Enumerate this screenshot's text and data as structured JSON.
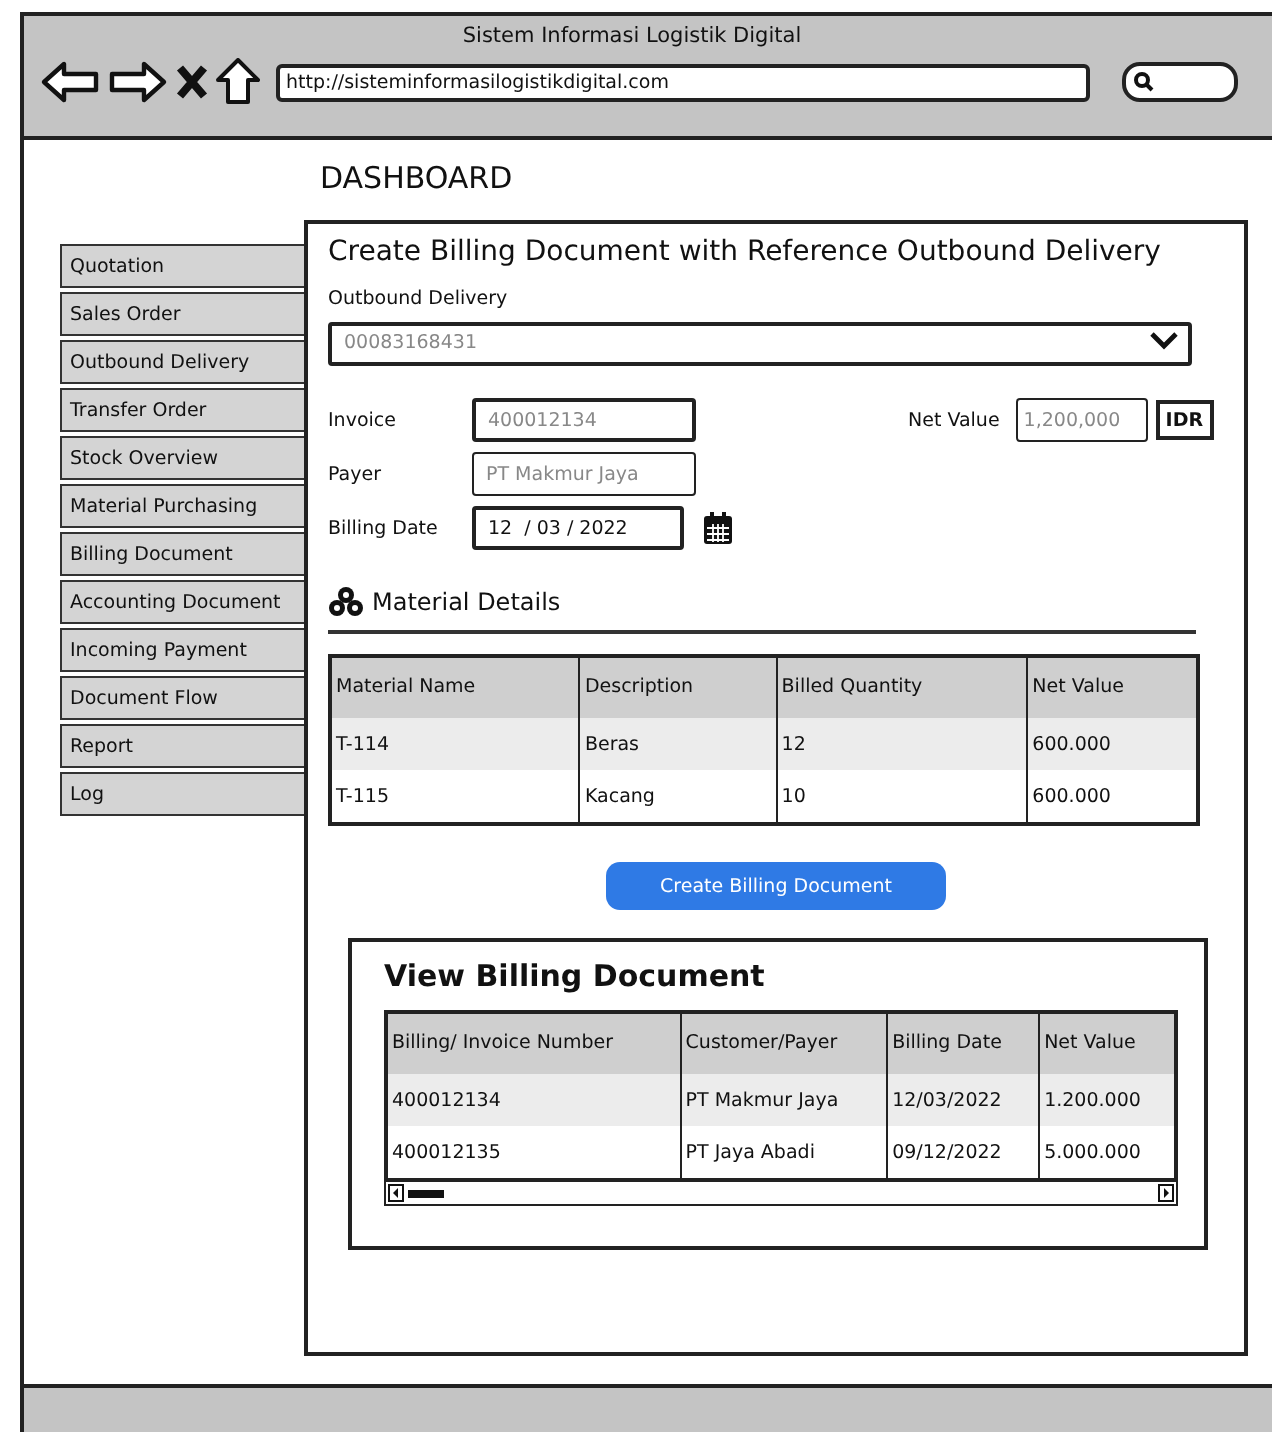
{
  "window": {
    "title": "Sistem Informasi Logistik Digital",
    "url": "http://sisteminformasilogistikdigital.com"
  },
  "page_title": "DASHBOARD",
  "sidebar": {
    "items": [
      {
        "label": "Quotation"
      },
      {
        "label": "Sales Order"
      },
      {
        "label": "Outbound Delivery"
      },
      {
        "label": "Transfer Order"
      },
      {
        "label": "Stock Overview"
      },
      {
        "label": "Material Purchasing"
      },
      {
        "label": "Billing Document"
      },
      {
        "label": "Accounting Document"
      },
      {
        "label": "Incoming Payment"
      },
      {
        "label": "Document Flow"
      },
      {
        "label": "Report"
      },
      {
        "label": "Log"
      }
    ]
  },
  "form": {
    "title": "Create Billing Document with Reference Outbound Delivery",
    "outbound_delivery": {
      "label": "Outbound Delivery",
      "placeholder": "00083168431"
    },
    "invoice": {
      "label": "Invoice",
      "placeholder": "400012134"
    },
    "payer": {
      "label": "Payer",
      "placeholder": "PT Makmur Jaya"
    },
    "billing_date": {
      "label": "Billing Date",
      "value": "12  / 03 / 2022"
    },
    "net_value": {
      "label": "Net Value",
      "placeholder": "1,200,000",
      "currency": "IDR"
    }
  },
  "material_details": {
    "title": "Material Details",
    "columns": [
      "Material Name",
      "Description",
      "Billed Quantity",
      "Net Value"
    ],
    "rows": [
      [
        "T-114",
        "Beras",
        "12",
        "600.000"
      ],
      [
        "T-115",
        "Kacang",
        "10",
        "600.000"
      ]
    ]
  },
  "create_button": "Create Billing Document",
  "view_billing": {
    "title": "View Billing Document",
    "columns": [
      "Billing/ Invoice Number",
      "Customer/Payer",
      "Billing Date",
      "Net Value"
    ],
    "rows": [
      [
        "400012134",
        "PT Makmur Jaya",
        "12/03/2022",
        "1.200.000"
      ],
      [
        "400012135",
        "PT Jaya Abadi",
        "09/12/2022",
        "5.000.000"
      ]
    ]
  }
}
